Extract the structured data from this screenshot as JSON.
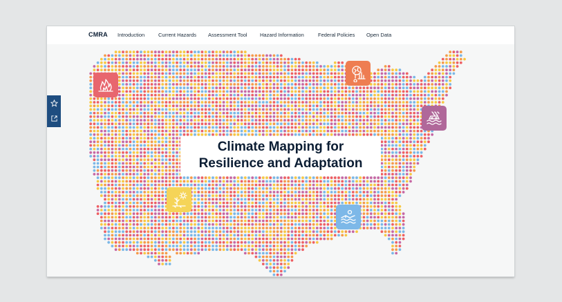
{
  "nav": {
    "brand": "CMRA",
    "items": [
      {
        "label": "Introduction"
      },
      {
        "label": "Current Hazards"
      },
      {
        "label": "Assessment Tool"
      },
      {
        "label": "Hazard Information"
      },
      {
        "label": "Federal Policies"
      },
      {
        "label": "Open Data"
      }
    ]
  },
  "hero": {
    "title_line1": "Climate Mapping for",
    "title_line2": "Resilience and Adaptation"
  },
  "sidebar": {
    "icons": [
      "star-icon",
      "share-icon"
    ],
    "color": "#1e4d80"
  },
  "hazard_tiles": [
    {
      "icon": "wildfire-icon",
      "color": "#e8666e"
    },
    {
      "icon": "extreme-heat-icon",
      "color": "#ee7d52"
    },
    {
      "icon": "coastal-inundation-icon",
      "color": "#b0689a"
    },
    {
      "icon": "drought-icon",
      "color": "#f5d458"
    },
    {
      "icon": "inland-flooding-icon",
      "color": "#7db8e8"
    }
  ],
  "dot_colors": [
    "#ee5f63",
    "#f59a4a",
    "#f7c843",
    "#c667a4",
    "#7ab7e6"
  ]
}
